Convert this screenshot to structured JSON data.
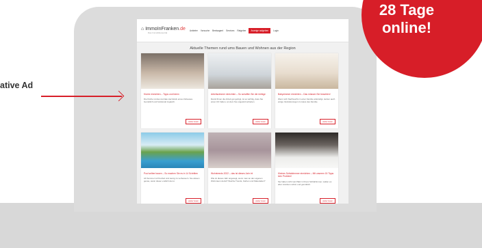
{
  "badge": {
    "line1": "28 Tage",
    "line2": "online!"
  },
  "ad_label": "ative Ad",
  "site": {
    "logo": "ImmoInFranken",
    "logo_suffix": ".de",
    "logo_sub": "Das Immobilienportal",
    "nav": [
      {
        "label": "Anbieter"
      },
      {
        "label": "Vorsuche"
      },
      {
        "label": "Bestsagent"
      },
      {
        "label": "Services"
      },
      {
        "label": "Ratgeber"
      },
      {
        "label": "Anzeige aufgeben",
        "accent": true
      },
      {
        "label": "Login"
      }
    ],
    "section_title": "Aktuelle Themen rund ums Bauen und Wohnen aus der Region"
  },
  "cards": [
    {
      "title": "Küche einrichten – Tipps und Ideen",
      "text": "Die Küche ist das zentrale Herzstück eines Zuhauses. Gemütlich und funktional zugleich.",
      "more": "weiter lesen",
      "icon": "kitchen-photo"
    },
    {
      "title": "Arbeitszimmer einrichten – So schaffen Sie die richtige",
      "text": "Damit Ihnen die Arbeit gut gelingt, ist es wichtig, dass Sie einen Ort haben, an dem Sie ungestört arbeiten.",
      "more": "weiter lesen",
      "icon": "office-photo"
    },
    {
      "title": "Babyzimmer einrichten – Das müssen Sie beachten!",
      "text": "Wenn sich Nachwuchs in einer Familie ankündigt, stehen auch einige Veränderungen im Haus des Familie.",
      "more": "weiter lesen",
      "icon": "nursery-photo"
    },
    {
      "title": "Pool selber bauen – So machen Sie es in 14 Schritten",
      "text": "Ab Sommer ist Poolzeit und wenig zu verbessern. Sie wissen genau, wann dieser endlich da ist.",
      "more": "weiter lesen",
      "icon": "pool-photo"
    },
    {
      "title": "Wohntrends 2022 – das ist dieses Jahr in!",
      "text": "Wie ist dieses Jahr angesagt, wenn man an den eigenen Wohnraum denkt? Welche Trends, Farben und Materialien?",
      "more": "weiter lesen",
      "icon": "livingroom-photo"
    },
    {
      "title": "Kleines Schlafzimmer einrichten – Mit unseren 15 Tipps kein Problem!",
      "text": "Sie haben nicht viel Platz in Ihrem Schlafzimmer, wollen es aber trotzdem schön und gemütlich.",
      "more": "weiter lesen",
      "icon": "bedroom-photo"
    }
  ],
  "colors": {
    "accent": "#d71e28"
  }
}
